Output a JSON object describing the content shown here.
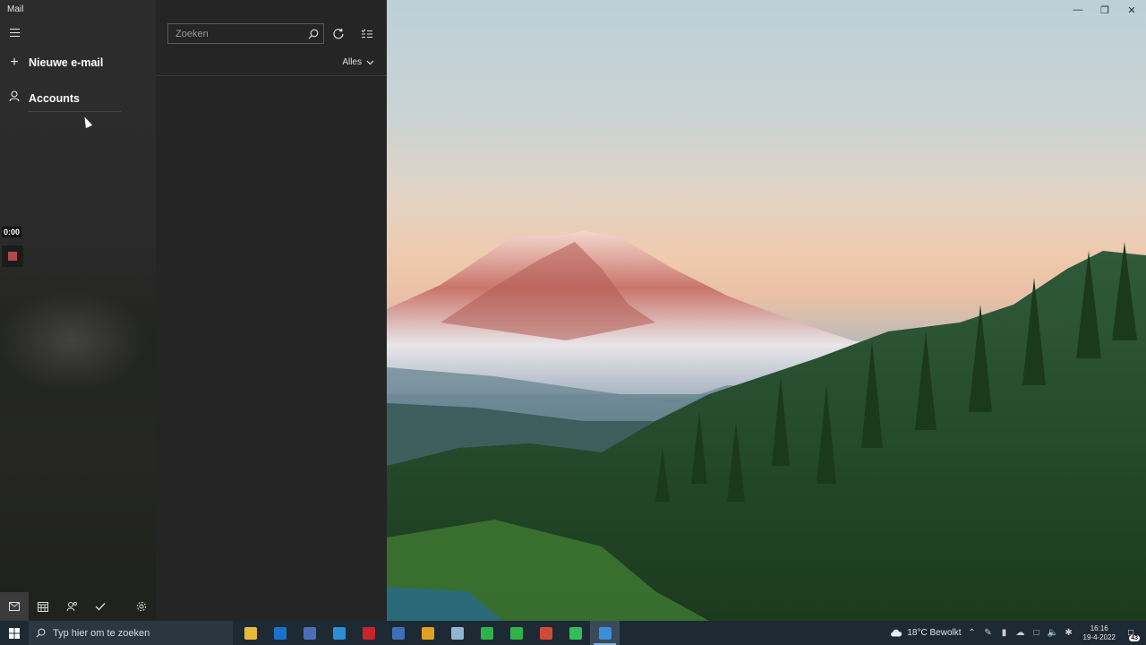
{
  "app": {
    "title": "Mail"
  },
  "nav": {
    "new_mail_label": "Nieuwe e-mail",
    "accounts_label": "Accounts"
  },
  "recorder": {
    "timer": "0:00"
  },
  "list": {
    "search_placeholder": "Zoeken",
    "filter_label": "Alles"
  },
  "bottom_icons": [
    "mail-icon",
    "calendar-icon",
    "people-icon",
    "todo-icon",
    "settings-icon"
  ],
  "taskbar": {
    "search_placeholder": "Typ hier om te zoeken",
    "apps": [
      {
        "name": "file-explorer",
        "color": "#e8b93a"
      },
      {
        "name": "outlook",
        "color": "#1a73c8"
      },
      {
        "name": "app-3",
        "color": "#4a6fb8"
      },
      {
        "name": "vscode",
        "color": "#2a8fd8"
      },
      {
        "name": "filezilla",
        "color": "#c8242b"
      },
      {
        "name": "app-6",
        "color": "#3f6fb8"
      },
      {
        "name": "chrome",
        "color": "#e0a020"
      },
      {
        "name": "app-8",
        "color": "#8fb8d0"
      },
      {
        "name": "app-9",
        "color": "#2fb24a"
      },
      {
        "name": "app-10",
        "color": "#2fb24a"
      },
      {
        "name": "chrome-2",
        "color": "#d04a3a"
      },
      {
        "name": "whatsapp",
        "color": "#2fbf5a"
      },
      {
        "name": "mail",
        "color": "#3a8fd8"
      }
    ],
    "weather": "18°C  Bewolkt",
    "time": "16:16",
    "date": "19-4-2022",
    "notification_count": "43"
  }
}
